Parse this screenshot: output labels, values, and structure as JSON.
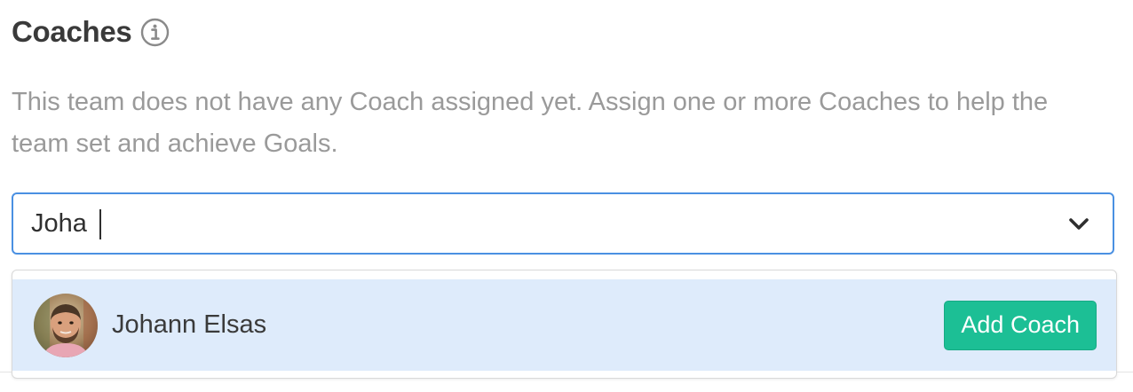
{
  "section": {
    "title": "Coaches",
    "info_icon": "info-icon",
    "description": "This team does not have any Coach assigned yet. Assign one or more Coaches to help the team set and achieve Goals."
  },
  "search": {
    "value": "Joha",
    "dropdown_icon": "chevron-down-icon"
  },
  "results": [
    {
      "name": "Johann Elsas",
      "avatar": "avatar-photo",
      "action_label": "Add Coach"
    }
  ],
  "colors": {
    "focus_border": "#4a90e2",
    "highlight_bg": "#deebfb",
    "button_bg": "#1cbf95",
    "muted_text": "#9a9a9a"
  }
}
